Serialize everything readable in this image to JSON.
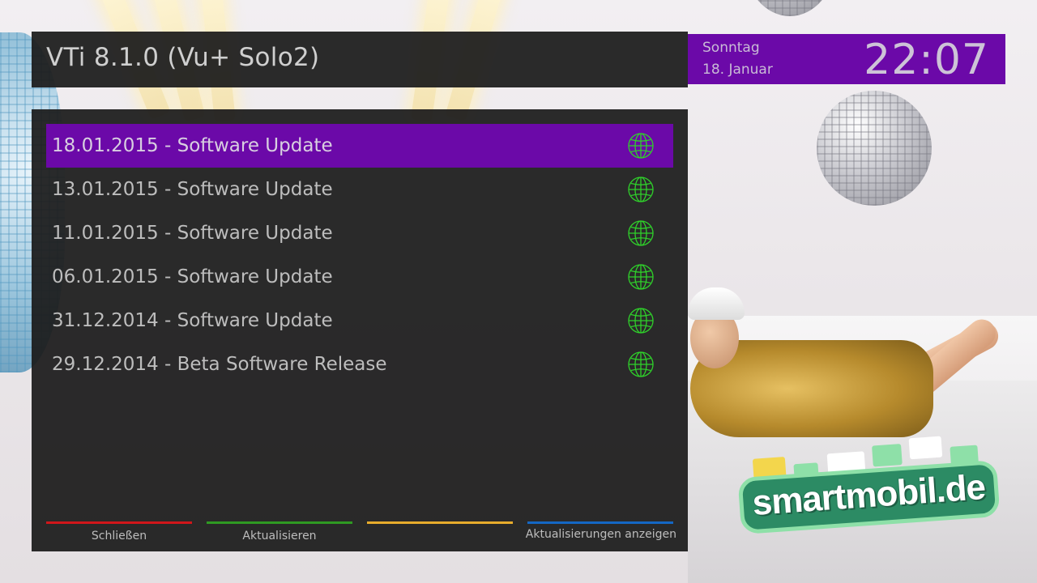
{
  "header": {
    "title": "VTi 8.1.0 (Vu+ Solo2)"
  },
  "clock": {
    "day": "Sonntag",
    "date": "18. Januar",
    "time": "22:07"
  },
  "updates": {
    "selected_index": 0,
    "items": [
      {
        "label": "18.01.2015 - Software Update",
        "icon": "globe-icon"
      },
      {
        "label": "13.01.2015 - Software Update",
        "icon": "globe-icon"
      },
      {
        "label": "11.01.2015 - Software Update",
        "icon": "globe-icon"
      },
      {
        "label": "06.01.2015 - Software Update",
        "icon": "globe-icon"
      },
      {
        "label": "31.12.2014 - Software Update",
        "icon": "globe-icon"
      },
      {
        "label": "29.12.2014 - Beta Software Release",
        "icon": "globe-icon"
      }
    ]
  },
  "color_buttons": [
    {
      "color": "#d0161a",
      "label": "Schließen"
    },
    {
      "color": "#2f9a22",
      "label": "Aktualisieren"
    },
    {
      "color": "#e8ac2c",
      "label": ""
    },
    {
      "color": "#1467c4",
      "label": "Aktualisierungen anzeigen"
    }
  ],
  "colors": {
    "accent": "#6b09a8",
    "icon": "#2fd12a",
    "panel": "#1b1b1b"
  },
  "background": {
    "logo_text": "smartmobil.de"
  }
}
